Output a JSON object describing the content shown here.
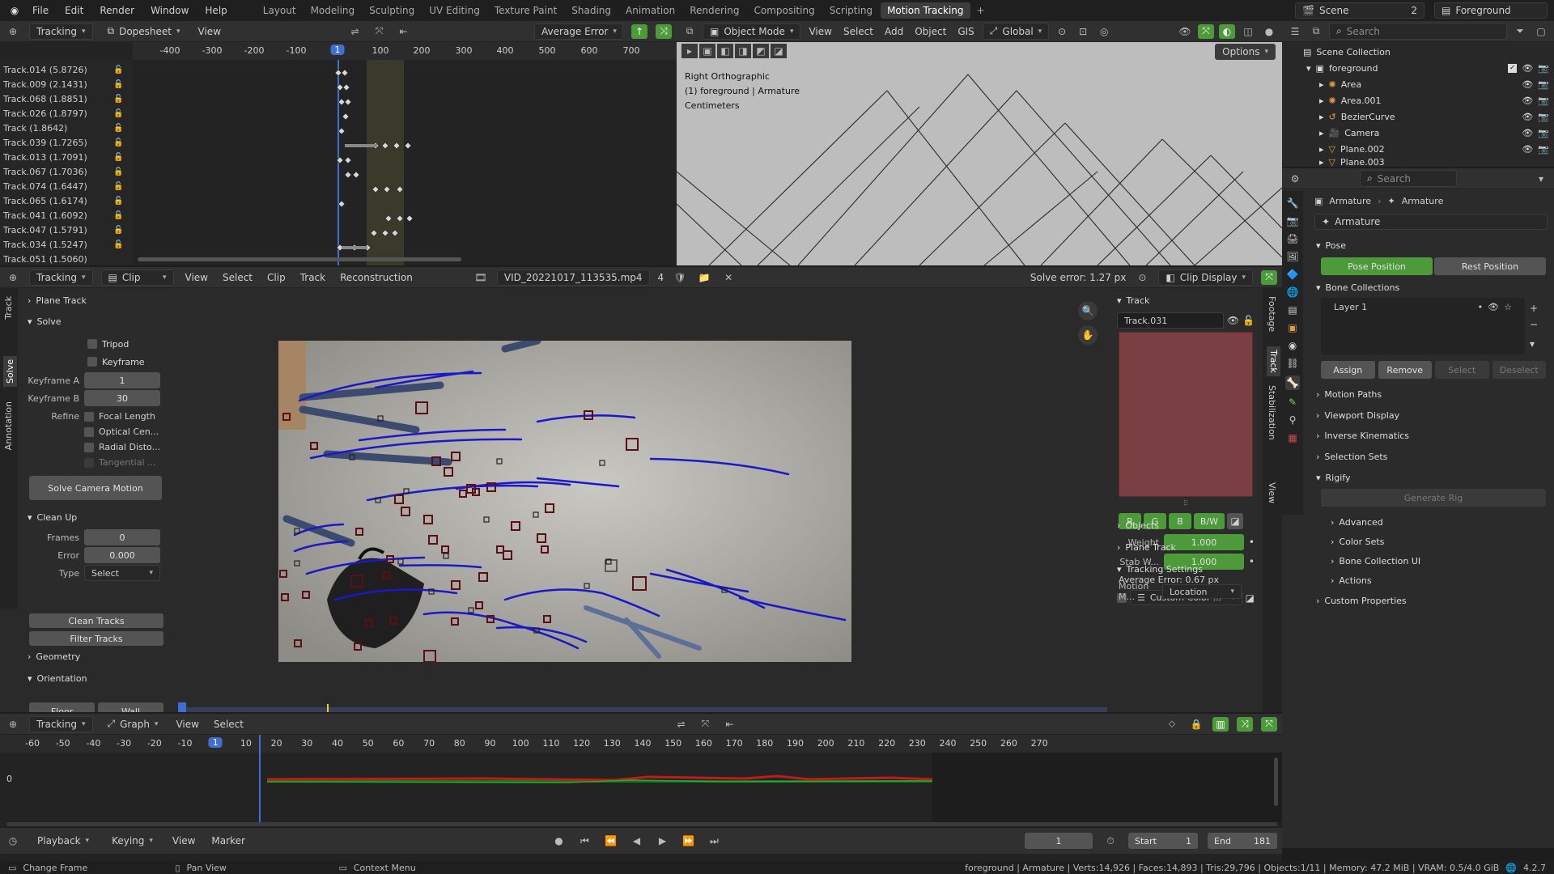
{
  "topbar": {
    "menus": [
      "File",
      "Edit",
      "Render",
      "Window",
      "Help"
    ],
    "workspaces": [
      "Layout",
      "Modeling",
      "Sculpting",
      "UV Editing",
      "Texture Paint",
      "Shading",
      "Animation",
      "Rendering",
      "Compositing",
      "Scripting",
      "Motion Tracking"
    ],
    "active_workspace": "Motion Tracking",
    "scene_label": "Scene",
    "scene_count": "2",
    "view_layer": "Foreground"
  },
  "dopesheet": {
    "editor_mode": "Tracking",
    "view_mode": "Dopesheet",
    "view_menu": "View",
    "sort": "Average Error",
    "current_frame": "1",
    "ticks": [
      "-400",
      "-300",
      "-200",
      "-100",
      "1",
      "100",
      "200",
      "300",
      "400",
      "500",
      "600",
      "700"
    ],
    "tracks": [
      "Track.014 (5.8726)",
      "Track.009 (2.1431)",
      "Track.068 (1.8851)",
      "Track.026 (1.8797)",
      "Track (1.8642)",
      "Track.039 (1.7265)",
      "Track.013 (1.7091)",
      "Track.067 (1.7036)",
      "Track.074 (1.6447)",
      "Track.065 (1.6174)",
      "Track.041 (1.6092)",
      "Track.047 (1.5791)",
      "Track.034 (1.5247)",
      "Track.051 (1.5060)"
    ]
  },
  "viewport": {
    "mode": "Object Mode",
    "menus": [
      "View",
      "Select",
      "Add",
      "Object",
      "GIS"
    ],
    "orientation": "Global",
    "options": "Options",
    "overlay_title": "Right Orthographic",
    "overlay_sub": "(1) foreground | Armature",
    "overlay_units": "Centimeters"
  },
  "outliner": {
    "search_placeholder": "Search",
    "root": "Scene Collection",
    "collection": "foreground",
    "items": [
      "Area",
      "Area.001",
      "BezierCurve",
      "Camera",
      "Plane.002",
      "Plane.003"
    ]
  },
  "properties": {
    "search_placeholder": "Search",
    "breadcrumb_a": "Armature",
    "breadcrumb_b": "Armature",
    "data_name": "Armature",
    "pose_label": "Pose",
    "pose_position": "Pose Position",
    "rest_position": "Rest Position",
    "bone_collections": "Bone Collections",
    "layer": "Layer 1",
    "assign": "Assign",
    "remove": "Remove",
    "select": "Select",
    "deselect": "Deselect",
    "sections": [
      "Motion Paths",
      "Viewport Display",
      "Inverse Kinematics",
      "Selection Sets"
    ],
    "rigify": "Rigify",
    "generate_rig": "Generate Rig",
    "rigify_sub": [
      "Advanced",
      "Color Sets",
      "Bone Collection UI",
      "Actions"
    ],
    "custom_properties": "Custom Properties"
  },
  "clip": {
    "editor_mode": "Tracking",
    "view_mode": "Clip",
    "menus": [
      "View",
      "Select",
      "Clip",
      "Track",
      "Reconstruction"
    ],
    "clip_name": "VID_20221017_113535.mp4",
    "clip_users": "4",
    "solve_error": "Solve error: 1.27 px",
    "clip_display": "Clip Display"
  },
  "solve_panel": {
    "tabs": [
      "Track",
      "Solve",
      "Annotation"
    ],
    "plane_track": "Plane Track",
    "solve": "Solve",
    "tripod": "Tripod",
    "keyframe": "Keyframe",
    "keyframe_a_label": "Keyframe A",
    "keyframe_a": "1",
    "keyframe_b_label": "Keyframe B",
    "keyframe_b": "30",
    "refine_label": "Refine",
    "refine_options": [
      "Focal Length",
      "Optical Cen...",
      "Radial Disto...",
      "Tangential ..."
    ],
    "solve_button": "Solve Camera Motion",
    "clean_up": "Clean Up",
    "frames_label": "Frames",
    "frames": "0",
    "error_label": "Error",
    "error": "0.000",
    "type_label": "Type",
    "type": "Select",
    "clean_tracks": "Clean Tracks",
    "filter_tracks": "Filter Tracks",
    "geometry": "Geometry",
    "orientation": "Orientation",
    "floor": "Floor",
    "wall": "Wall"
  },
  "track_panel": {
    "header": "Track",
    "track_name": "Track.031",
    "channels": [
      "R",
      "G",
      "B",
      "B/W"
    ],
    "weight_label": "Weight",
    "weight": "1.000",
    "stab_label": "Stab W...",
    "stab": "1.000",
    "avg_error": "Average Error: 0.67 px",
    "custom_color": "Custom Color ...",
    "objects": "Objects",
    "plane_track": "Plane Track",
    "tracking_settings": "Tracking Settings",
    "motion_label": "Motion M...",
    "motion": "Location",
    "side_tabs": [
      "Footage",
      "Track",
      "Stabilization",
      "View"
    ]
  },
  "graph": {
    "editor_mode": "Tracking",
    "view_mode": "Graph",
    "menus": [
      "View",
      "Select"
    ],
    "ticks": [
      "-60",
      "-50",
      "-40",
      "-30",
      "-20",
      "-10",
      "1",
      "10",
      "20",
      "30",
      "40",
      "50",
      "60",
      "70",
      "80",
      "90",
      "100",
      "110",
      "120",
      "130",
      "140",
      "150",
      "160",
      "170",
      "180",
      "190",
      "200",
      "210",
      "220",
      "230",
      "240",
      "250",
      "260",
      "270"
    ],
    "zero_label": "0"
  },
  "timeline": {
    "playback": "Playback",
    "keying": "Keying",
    "view": "View",
    "marker": "Marker",
    "current_frame": "1",
    "start_label": "Start",
    "start": "1",
    "end_label": "End",
    "end": "181"
  },
  "statusbar": {
    "change_frame": "Change Frame",
    "pan_view": "Pan View",
    "context_menu": "Context Menu",
    "stats": "foreground | Armature | Verts:14,926 | Faces:14,893 | Tris:29,796 | Objects:1/11 | Memory: 47.2 MiB | VRAM: 0.5/4.0 GiB",
    "version": "4.2.7"
  },
  "colors": {
    "accent": "#4c9a3a",
    "active_frame": "#3f6fd3",
    "track_curve": "#1a18c8",
    "marker": "#5a0f14",
    "track_preview": "#7a3f42"
  }
}
